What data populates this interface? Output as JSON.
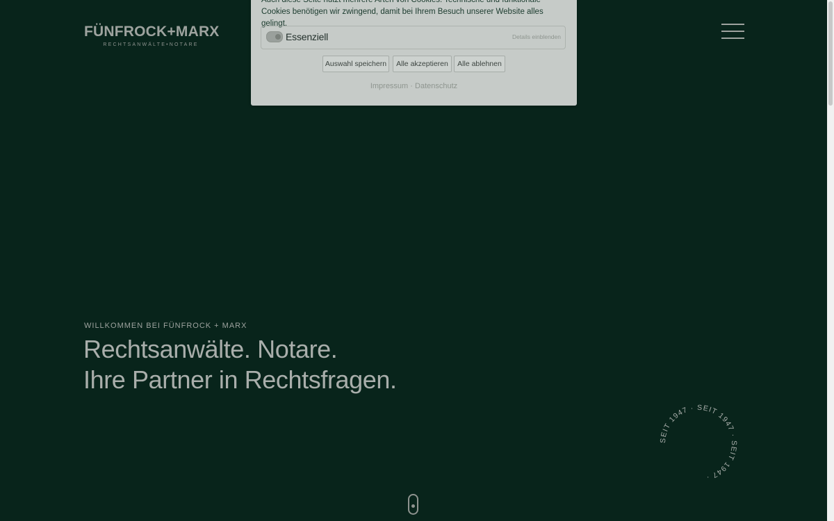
{
  "header": {
    "logo_name": "FÜNFROCK+MARX",
    "logo_subtitle": "RECHTSANWÄLTE•NOTARE",
    "menu_icon": "hamburger-menu-icon"
  },
  "hero": {
    "eyebrow": "WILLKOMMEN BEI FÜNFROCK + MARX",
    "line1": "Rechtsanwälte. Notare.",
    "line2": "Ihre Partner in Rechtsfragen."
  },
  "badge": {
    "text": "SEIT 1947 · SEIT 1947 · SEIT 1947 · "
  },
  "scroll_indicator_icon": "mouse-scroll-icon",
  "cookie_banner": {
    "text": "Auch diese Seite nutzt mehrere Arten von Cookies. Technische und funktionale Cookies benötigen wir zwingend, damit bei Ihrem Besuch unserer Website alles gelingt.",
    "group_label": "Essenziell",
    "details_link": "Details einblenden",
    "buttons": {
      "save": "Auswahl speichern",
      "accept_all": "Alle akzeptieren",
      "reject_all": "Alle ablehnen"
    },
    "links": {
      "imprint": "Impressum",
      "separator": "·",
      "privacy": "Datenschutz"
    }
  },
  "colors": {
    "background": "#08241b",
    "text_muted": "#9ea39f",
    "banner_bg": "#c6cbc8"
  }
}
